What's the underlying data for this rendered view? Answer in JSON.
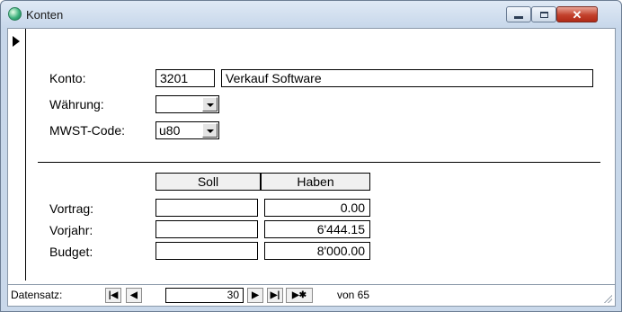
{
  "window": {
    "title": "Konten",
    "controls": {
      "minimize": "minimize-icon",
      "maximize": "maximize-icon",
      "close": "close-icon"
    }
  },
  "form": {
    "konto_label": "Konto:",
    "konto_number": "3201",
    "konto_name": "Verkauf Software",
    "waehrung_label": "Währung:",
    "waehrung_value": "",
    "mwst_label": "MWST-Code:",
    "mwst_value": "u80"
  },
  "amounts": {
    "soll_header": "Soll",
    "haben_header": "Haben",
    "rows": [
      {
        "label": "Vortrag:",
        "soll": "",
        "haben": "0.00"
      },
      {
        "label": "Vorjahr:",
        "soll": "",
        "haben": "6'444.15"
      },
      {
        "label": "Budget:",
        "soll": "",
        "haben": "8'000.00"
      }
    ]
  },
  "nav": {
    "label": "Datensatz:",
    "current": "30",
    "of_text": "von 65",
    "buttons": {
      "first": "|◀",
      "prev": "◀",
      "next": "▶",
      "last": "▶|",
      "new": "▶✱"
    }
  }
}
